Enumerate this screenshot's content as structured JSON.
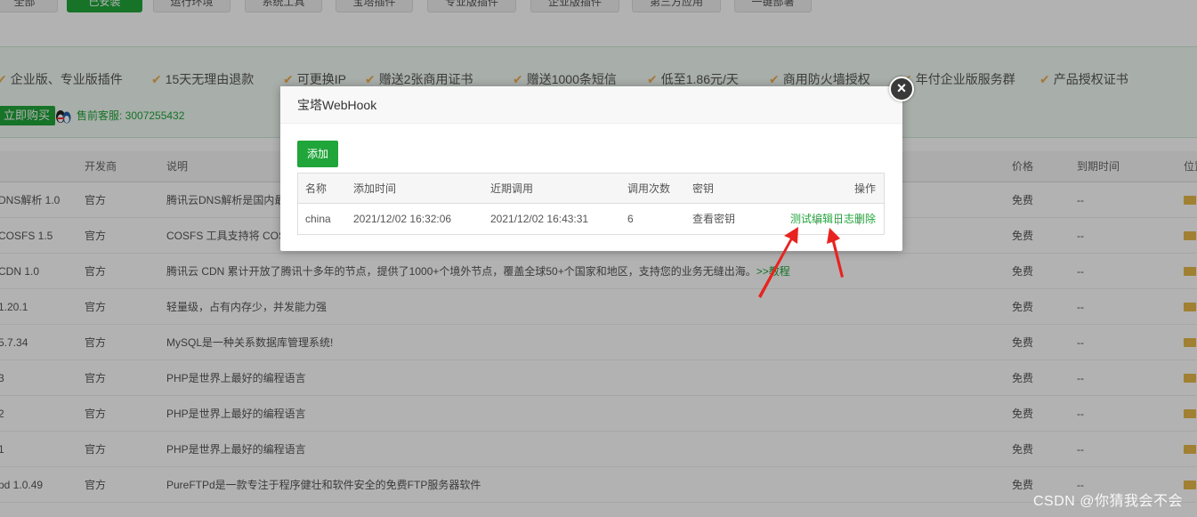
{
  "tabs": [
    {
      "label": "全部",
      "active": false
    },
    {
      "label": "已安装",
      "active": true
    },
    {
      "label": "运行环境",
      "active": false
    },
    {
      "label": "系统工具",
      "active": false
    },
    {
      "label": "宝塔插件",
      "active": false
    },
    {
      "label": "专业版插件",
      "active": false
    },
    {
      "label": "企业版插件",
      "active": false
    },
    {
      "label": "第三方应用",
      "active": false
    },
    {
      "label": "一键部署",
      "active": false
    }
  ],
  "promo": {
    "perks": [
      "企业版、专业版插件",
      "15天无理由退款",
      "可更换IP",
      "赠送2张商用证书",
      "赠送1000条短信",
      "低至1.86元/天",
      "商用防火墙授权",
      "年付企业版服务群",
      "产品授权证书"
    ],
    "buy_label": "立即购买",
    "support_text": "售前客服: 3007255432"
  },
  "plugin_table": {
    "headers": {
      "name": "",
      "developer": "开发商",
      "description": "说明",
      "price": "价格",
      "expiry": "到期时间",
      "location": "位置"
    },
    "rows": [
      {
        "name": "DNS解析 1.0",
        "developer": "官方",
        "description": "腾讯云DNS解析是国内最",
        "link": "",
        "price": "免费",
        "expiry": "--"
      },
      {
        "name": "COSFS 1.5",
        "developer": "官方",
        "description": "COSFS 工具支持将 COS",
        "link": "",
        "price": "免费",
        "expiry": "--"
      },
      {
        "name": "CDN 1.0",
        "developer": "官方",
        "description": "腾讯云 CDN 累计开放了腾讯十多年的节点，提供了1000+个境外节点，覆盖全球50+个国家和地区，支持您的业务无缝出海。",
        "link": ">>教程",
        "price": "免费",
        "expiry": "--"
      },
      {
        "name": "1.20.1",
        "developer": "官方",
        "description": "轻量级，占有内存少，并发能力强",
        "link": "",
        "price": "免费",
        "expiry": "--"
      },
      {
        "name": "5.7.34",
        "developer": "官方",
        "description": "MySQL是一种关系数据库管理系统!",
        "link": "",
        "price": "免费",
        "expiry": "--"
      },
      {
        "name": "3",
        "developer": "官方",
        "description": "PHP是世界上最好的编程语言",
        "link": "",
        "price": "免费",
        "expiry": "--"
      },
      {
        "name": "2",
        "developer": "官方",
        "description": "PHP是世界上最好的编程语言",
        "link": "",
        "price": "免费",
        "expiry": "--"
      },
      {
        "name": "1",
        "developer": "官方",
        "description": "PHP是世界上最好的编程语言",
        "link": "",
        "price": "免费",
        "expiry": "--"
      },
      {
        "name": "pd 1.0.49",
        "developer": "官方",
        "description": "PureFTPd是一款专注于程序健壮和软件安全的免费FTP服务器软件",
        "link": "",
        "price": "免费",
        "expiry": "--"
      }
    ]
  },
  "modal": {
    "title": "宝塔WebHook",
    "close_symbol": "×",
    "add_label": "添加",
    "headers": {
      "name": "名称",
      "added": "添加时间",
      "recent": "近期调用",
      "count": "调用次数",
      "secret": "密钥",
      "ops": "操作"
    },
    "rows": [
      {
        "name": "china",
        "added": "2021/12/02 16:32:06",
        "recent": "2021/12/02 16:43:31",
        "count": "6",
        "secret": "查看密钥",
        "op_test": "测试",
        "op_edit": "编辑",
        "op_log": "日志",
        "op_delete": "删除"
      }
    ]
  },
  "watermark": "CSDN @你猜我会不会",
  "colors": {
    "brand_green": "#20a53a",
    "check_orange": "#f0ad4e",
    "arrow_red": "#e8231f"
  }
}
